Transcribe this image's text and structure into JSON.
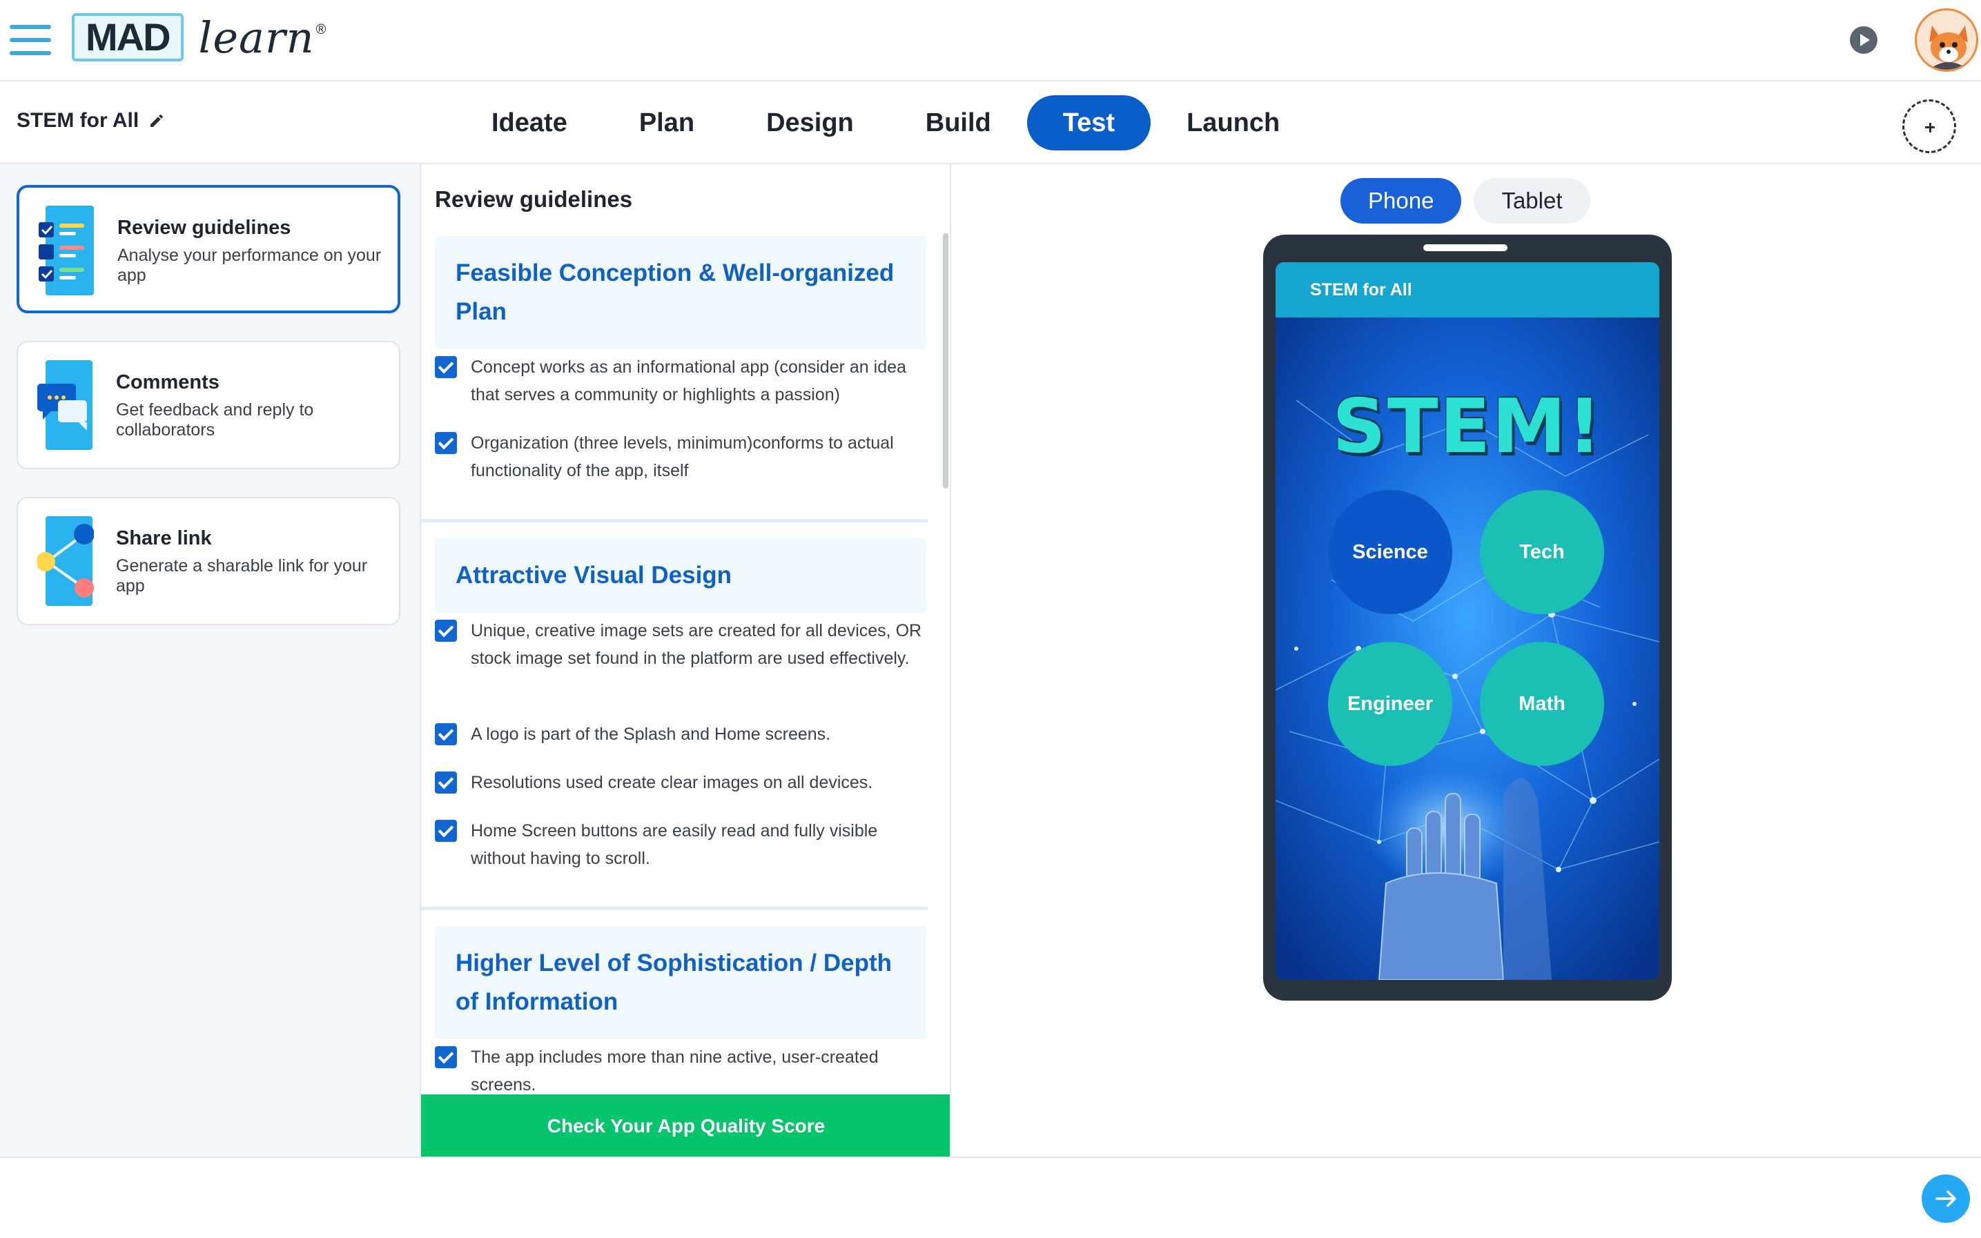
{
  "app": {
    "logo_text_mad": "MAD",
    "logo_text_learn": "learn",
    "logo_reg": "®"
  },
  "project": {
    "title": "STEM for All"
  },
  "stages": [
    "Ideate",
    "Plan",
    "Design",
    "Build",
    "Test",
    "Launch"
  ],
  "active_stage": "Test",
  "sidebar": {
    "cards": [
      {
        "title": "Review guidelines",
        "desc": "Analyse your performance on your app",
        "icon": "checklist-icon",
        "active": true
      },
      {
        "title": "Comments",
        "desc": "Get feedback and reply to collaborators",
        "icon": "chat-icon",
        "active": false
      },
      {
        "title": "Share link",
        "desc": "Generate a sharable link for your app",
        "icon": "share-icon",
        "active": false
      }
    ]
  },
  "guidelines": {
    "heading": "Review guidelines",
    "sections": [
      {
        "title": "Feasible Conception & Well-organized Plan",
        "items": [
          "Concept works as an informational app (consider an idea that serves a community or highlights a passion)",
          "Organization (three levels, minimum)conforms to actual functionality of the app, itself"
        ]
      },
      {
        "title": "Attractive Visual Design",
        "items": [
          "Unique, creative image sets are created for all devices, OR stock image set found in the platform are used effectively.",
          "A logo is part of the Splash and Home screens.",
          "Resolutions used create clear images on all devices.",
          "Home Screen buttons are easily read and fully visible without having to scroll."
        ]
      },
      {
        "title": "Higher Level of Sophistication / Depth of Information",
        "items": [
          "The app includes more than nine active, user-created screens."
        ]
      }
    ],
    "cta": "Check Your App Quality Score"
  },
  "preview": {
    "devices": [
      "Phone",
      "Tablet"
    ],
    "active_device": "Phone",
    "screen_title": "STEM for All",
    "hero_text": "STEM!",
    "buttons": [
      "Science",
      "Tech",
      "Engineer",
      "Math"
    ]
  },
  "colors": {
    "primary": "#0a5ec9",
    "cta_green": "#05c46b",
    "section_text": "#1161c4",
    "next_button": "#26a9f4"
  }
}
